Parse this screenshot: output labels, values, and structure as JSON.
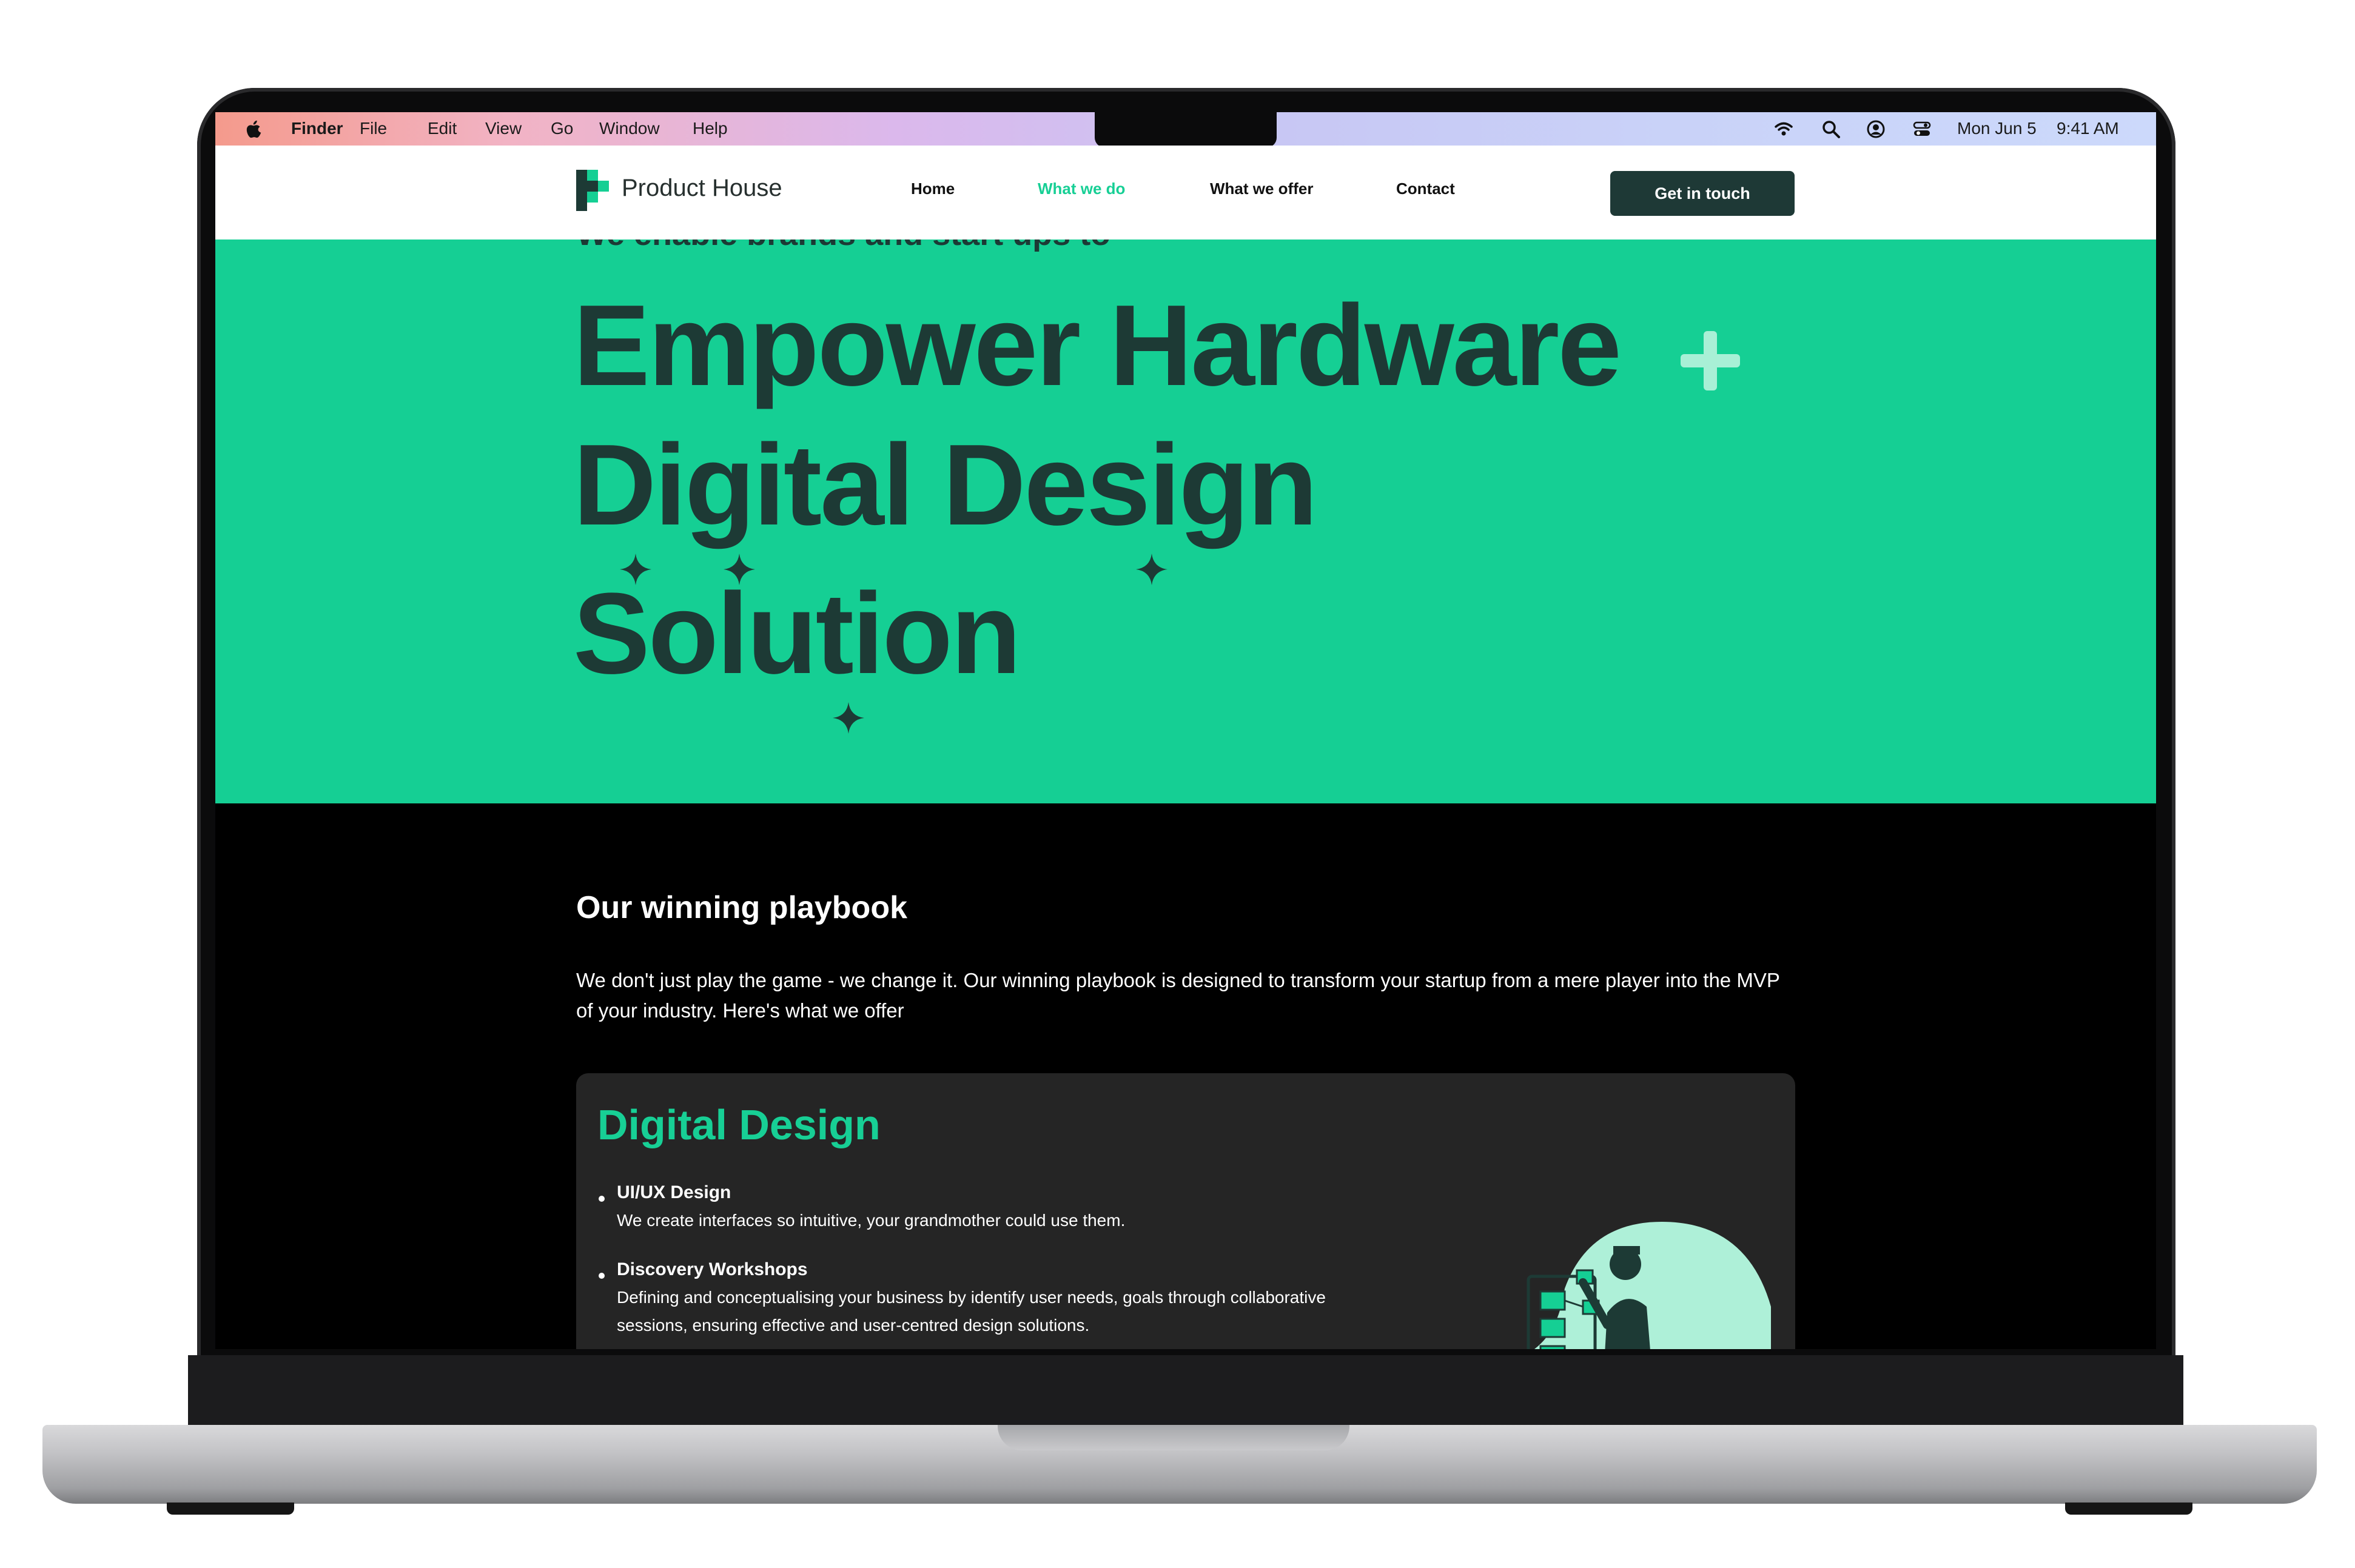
{
  "menubar": {
    "items": [
      "Finder",
      "File",
      "Edit",
      "View",
      "Go",
      "Window",
      "Help"
    ],
    "date": "Mon Jun 5",
    "time": "9:41 AM",
    "icons": [
      "apple-icon",
      "wifi-icon",
      "search-icon",
      "user-icon",
      "control-center-icon"
    ]
  },
  "site": {
    "brand": "Product House",
    "nav": [
      "Home",
      "What we do",
      "What we offer",
      "Contact"
    ],
    "active_nav": "What we do",
    "cta": "Get in touch"
  },
  "hero": {
    "kicker": "We enable brands and start ups to",
    "lines": [
      "Empower Hardware",
      "Digital Design",
      "Solution"
    ]
  },
  "playbook": {
    "title": "Our winning playbook",
    "text": "We don't just play the game - we change it. Our winning playbook is designed to transform your startup from a mere player into the MVP of your industry. Here's what we offer"
  },
  "card": {
    "title": "Digital Design",
    "items": [
      {
        "title": "UI/UX Design",
        "desc": "We create interfaces so intuitive, your grandmother could use them."
      },
      {
        "title": "Discovery Workshops",
        "desc": "Defining and conceptualising your business by identify user needs, goals through collaborative sessions, ensuring effective and user-centred design solutions."
      }
    ]
  },
  "colors": {
    "accent": "#15cf94",
    "dark_text": "#1d3a35",
    "cta_bg": "#1e3936",
    "card_bg": "#252525"
  }
}
